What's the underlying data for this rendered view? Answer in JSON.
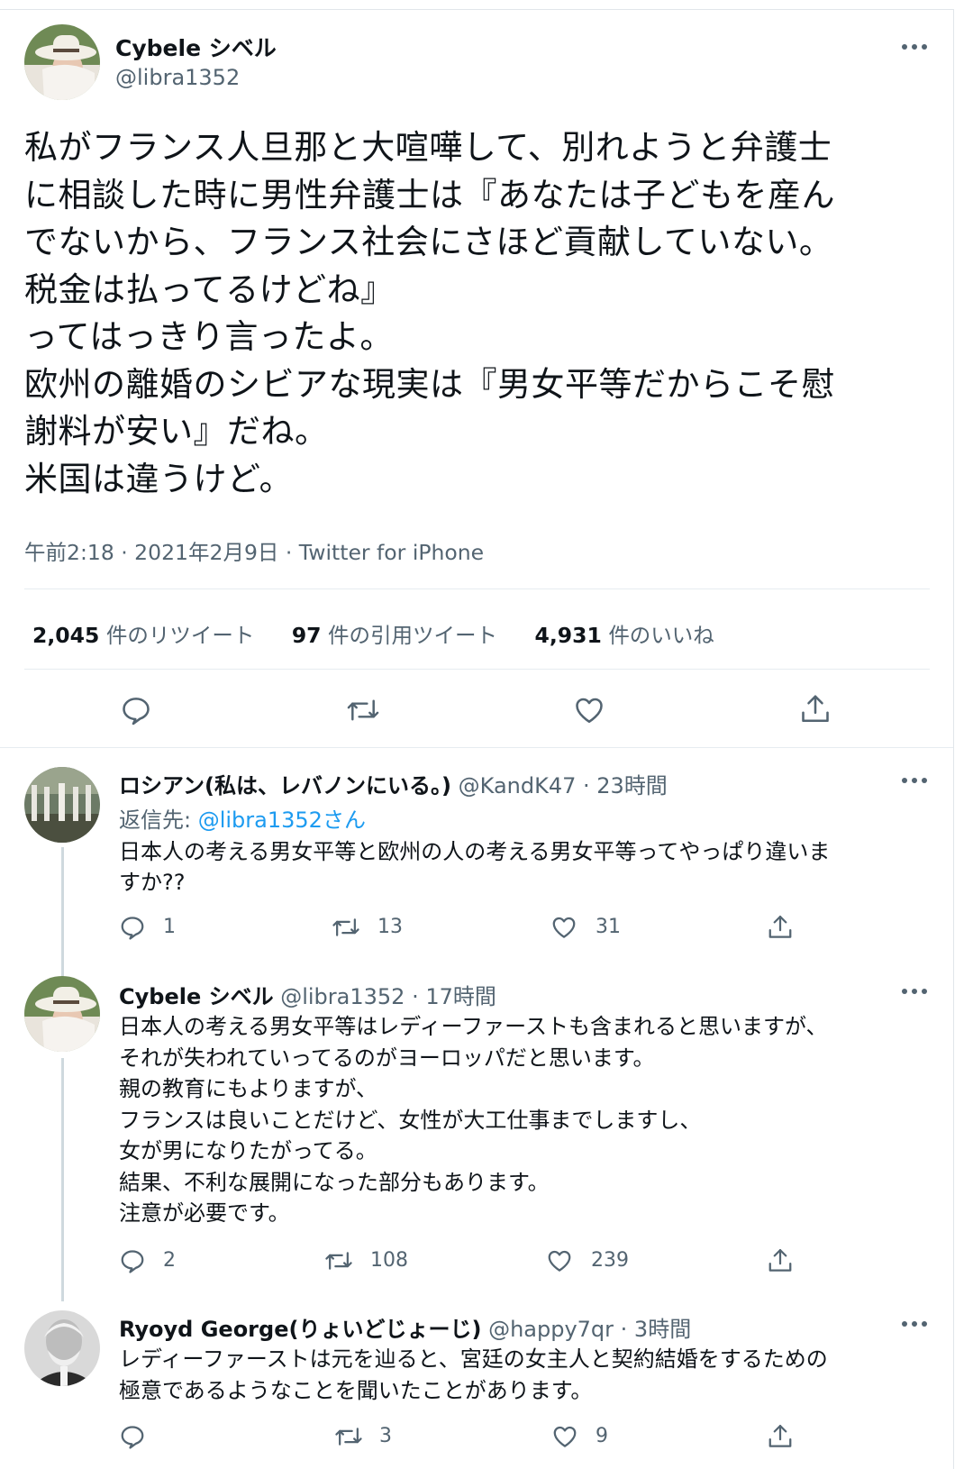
{
  "main_tweet": {
    "author_name": "Cybele シベル",
    "author_handle": "@libra1352",
    "text": "私がフランス人旦那と大喧嘩して、別れようと弁護士\nに相談した時に男性弁護士は『あなたは子どもを産ん\nでないから、フランス社会にさほど貢献していない。\n税金は払ってるけどね』\nってはっきり言ったよ。\n欧州の離婚のシビアな現実は『男女平等だからこそ慰\n謝料が安い』だね。\n米国は違うけど。",
    "timestamp": "午前2:18 · 2021年2月9日 · Twitter for iPhone",
    "retweets_count": "2,045",
    "retweets_label": "件のリツイート",
    "quotes_count": "97",
    "quotes_label": "件の引用ツイート",
    "likes_count": "4,931",
    "likes_label": "件のいいね"
  },
  "replies": [
    {
      "author_name": "ロシアン(私は、レバノンにいる。)",
      "author_handle": "@KandK47",
      "time": "· 23時間",
      "reply_to_prefix": "返信先: ",
      "reply_to_handle": "@libra1352",
      "reply_to_suffix": "さん",
      "text": "日本人の考える男女平等と欧州の人の考える男女平等ってやっぱり違いま\nすか??",
      "replies": "1",
      "retweets": "13",
      "likes": "31"
    },
    {
      "author_name": "Cybele シベル",
      "author_handle": "@libra1352",
      "time": "· 17時間",
      "text": "日本人の考える男女平等はレディーファーストも含まれると思いますが、\nそれが失われていってるのがヨーロッパだと思います。\n親の教育にもよりますが、\nフランスは良いことだけど、女性が大工仕事までしますし、\n女が男になりたがってる。\n結果、不利な展開になった部分もあります。\n注意が必要です。",
      "replies": "2",
      "retweets": "108",
      "likes": "239"
    },
    {
      "author_name": "Ryoyd George(りょいどじょーじ)",
      "author_handle": "@happy7qr",
      "time": "· 3時間",
      "text": "レディーファーストは元を辿ると、宮廷の女主人と契約結婚をするための\n極意であるようなことを聞いたことがあります。",
      "replies": "",
      "retweets": "3",
      "likes": "9"
    }
  ],
  "icons": {
    "more": "more-horizontal-icon",
    "reply": "reply-bubble-icon",
    "retweet": "retweet-icon",
    "like": "heart-icon",
    "share": "share-icon"
  },
  "colors": {
    "text": "#0f1419",
    "secondary": "#536471",
    "link": "#1d9bf0",
    "divider": "#e6ecf0",
    "thread_line": "#cfd9de"
  }
}
